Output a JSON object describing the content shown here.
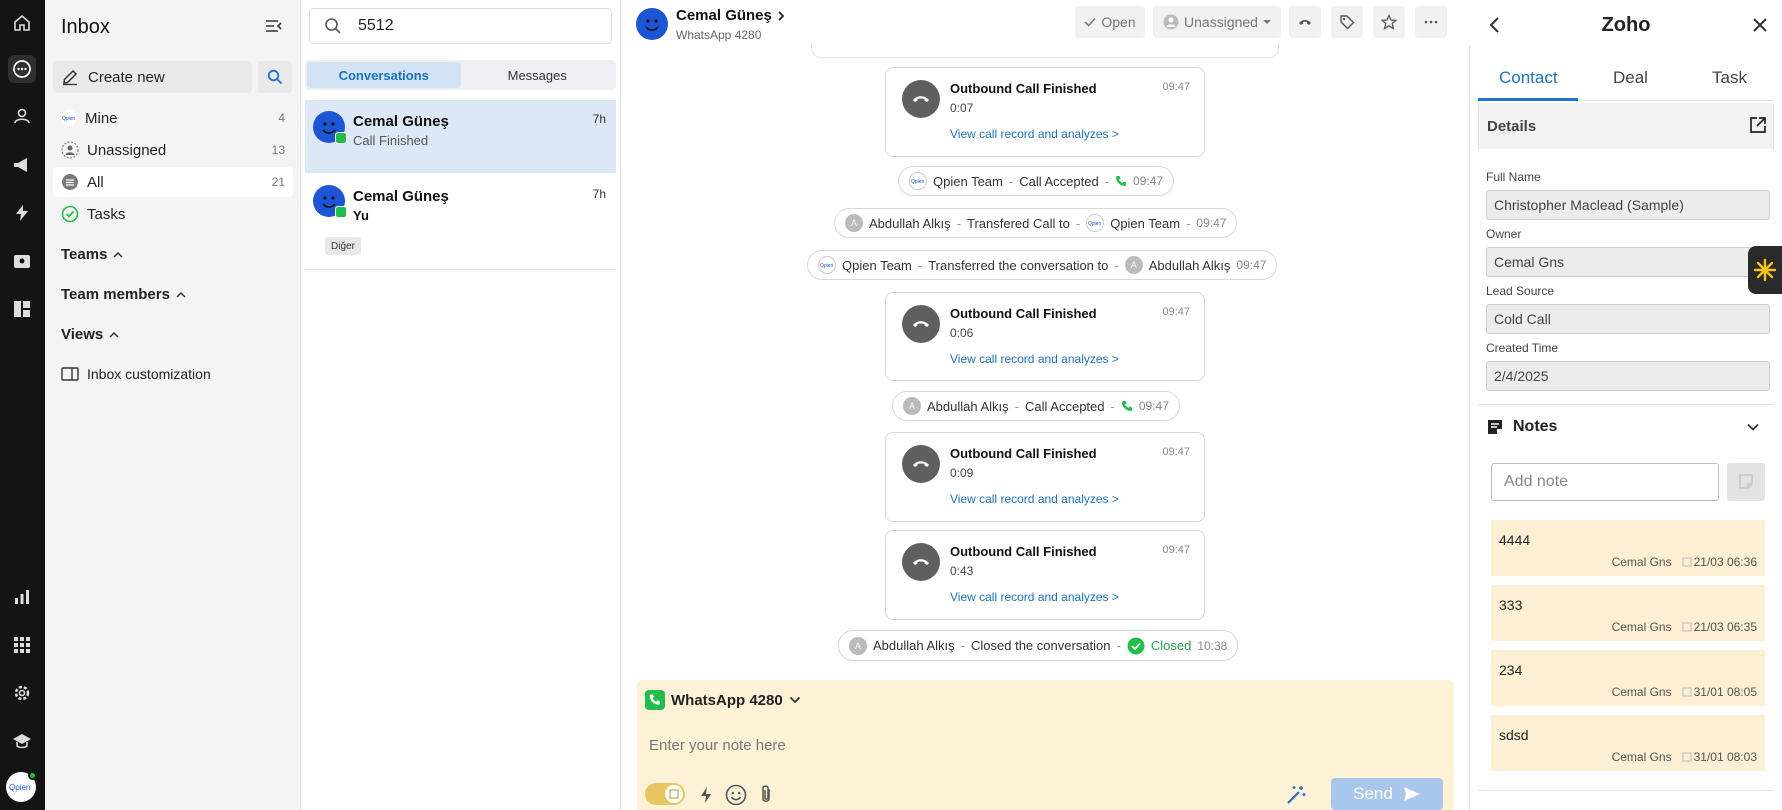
{
  "sidebar": {
    "title": "Inbox",
    "create_new": "Create new",
    "items": [
      {
        "label": "Mine",
        "count": "4"
      },
      {
        "label": "Unassigned",
        "count": "13"
      },
      {
        "label": "All",
        "count": "21"
      },
      {
        "label": "Tasks",
        "count": ""
      }
    ],
    "sections": [
      "Teams",
      "Team members",
      "Views"
    ],
    "customization": "Inbox customization"
  },
  "conv_list": {
    "search_value": "5512",
    "tabs": [
      "Conversations",
      "Messages"
    ],
    "items": [
      {
        "name": "Cemal Güneş",
        "preview": "Call Finished",
        "time": "7h"
      },
      {
        "name": "Cemal Güneş",
        "preview": "Yu",
        "time": "7h",
        "tag": "Diğer"
      }
    ]
  },
  "chat": {
    "contact_name": "Cemal Güneş",
    "channel": "WhatsApp 4280",
    "status_label": "Open",
    "assignee_label": "Unassigned",
    "cards": [
      {
        "title": "Outbound Call Finished",
        "duration": "0:07",
        "time": "09:47",
        "link": "View call record and analyzes >"
      },
      {
        "title": "Outbound Call Finished",
        "duration": "0:06",
        "time": "09:47",
        "link": "View call record and analyzes >"
      },
      {
        "title": "Outbound Call Finished",
        "duration": "0:09",
        "time": "09:47",
        "link": "View call record and analyzes >"
      },
      {
        "title": "Outbound Call Finished",
        "duration": "0:43",
        "time": "09:47",
        "link": "View call record and analyzes >"
      }
    ],
    "events": [
      {
        "actor": "Qpien Team",
        "action": "Call Accepted",
        "time": "09:47"
      },
      {
        "actor": "Abdullah Alkış",
        "action": "Transfered Call to",
        "target": "Qpien Team",
        "time": "09:47"
      },
      {
        "actor": "Qpien Team",
        "action": "Transferred the conversation to",
        "target": "Abdullah Alkış",
        "time": "09:47"
      },
      {
        "actor": "Abdullah Alkış",
        "action": "Call Accepted",
        "time": "09:47"
      },
      {
        "actor": "Abdullah Alkış",
        "action": "Closed the conversation",
        "status": "Closed",
        "time": "10:38"
      }
    ],
    "avatar_letter": "A",
    "composer": {
      "channel": "WhatsApp 4280",
      "placeholder": "Enter your note here",
      "send_label": "Send"
    }
  },
  "right_panel": {
    "title": "Zoho",
    "tabs": [
      "Contact",
      "Deal",
      "Task"
    ],
    "details_label": "Details",
    "fields": [
      {
        "label": "Full Name",
        "value": "Christopher Maclead (Sample)"
      },
      {
        "label": "Owner",
        "value": "Cemal Gns"
      },
      {
        "label": "Lead Source",
        "value": "Cold Call"
      },
      {
        "label": "Created Time",
        "value": "2/4/2025"
      }
    ],
    "notes_label": "Notes",
    "add_note_placeholder": "Add note",
    "notes": [
      {
        "text": "4444",
        "author": "Cemal Gns",
        "date": "21/03 06:36"
      },
      {
        "text": "333",
        "author": "Cemal Gns",
        "date": "21/03 06:35"
      },
      {
        "text": "234",
        "author": "Cemal Gns",
        "date": "31/01 08:05"
      },
      {
        "text": "sdsd",
        "author": "Cemal Gns",
        "date": "31/01 08:03"
      }
    ]
  },
  "colors": {
    "accent": "#1a73c8",
    "whatsapp": "#1fbf4a",
    "composer_bg": "#fdf1d6",
    "note_bg": "#fdefd3"
  }
}
